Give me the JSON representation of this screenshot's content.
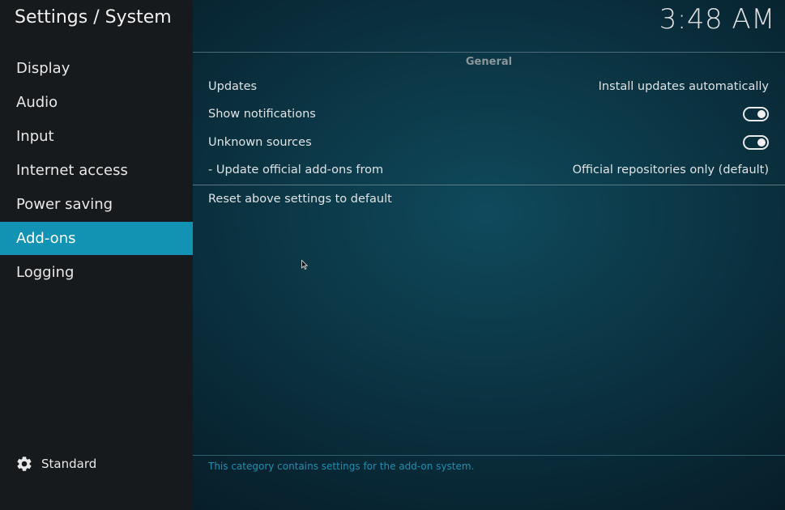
{
  "header": {
    "breadcrumb": "Settings / System",
    "clock": "3:48 AM"
  },
  "sidebar": {
    "items": [
      {
        "label": "Display"
      },
      {
        "label": "Audio"
      },
      {
        "label": "Input"
      },
      {
        "label": "Internet access"
      },
      {
        "label": "Power saving"
      },
      {
        "label": "Add-ons"
      },
      {
        "label": "Logging"
      }
    ],
    "active_index": 5,
    "level": {
      "icon": "gear-icon",
      "label": "Standard"
    }
  },
  "main": {
    "group_title": "General",
    "settings": [
      {
        "label": "Updates",
        "value": "Install updates automatically"
      },
      {
        "label": "Show notifications",
        "toggle": true
      },
      {
        "label": "Unknown sources",
        "toggle": true
      },
      {
        "label": "- Update official add-ons from",
        "value": "Official repositories only (default)"
      }
    ],
    "reset_label": "Reset above settings to default",
    "description": "This category contains settings for the add-on system."
  },
  "colors": {
    "accent": "#1393b4",
    "sidebar_bg": "#161a1d",
    "description_text": "#1f8fb0"
  }
}
